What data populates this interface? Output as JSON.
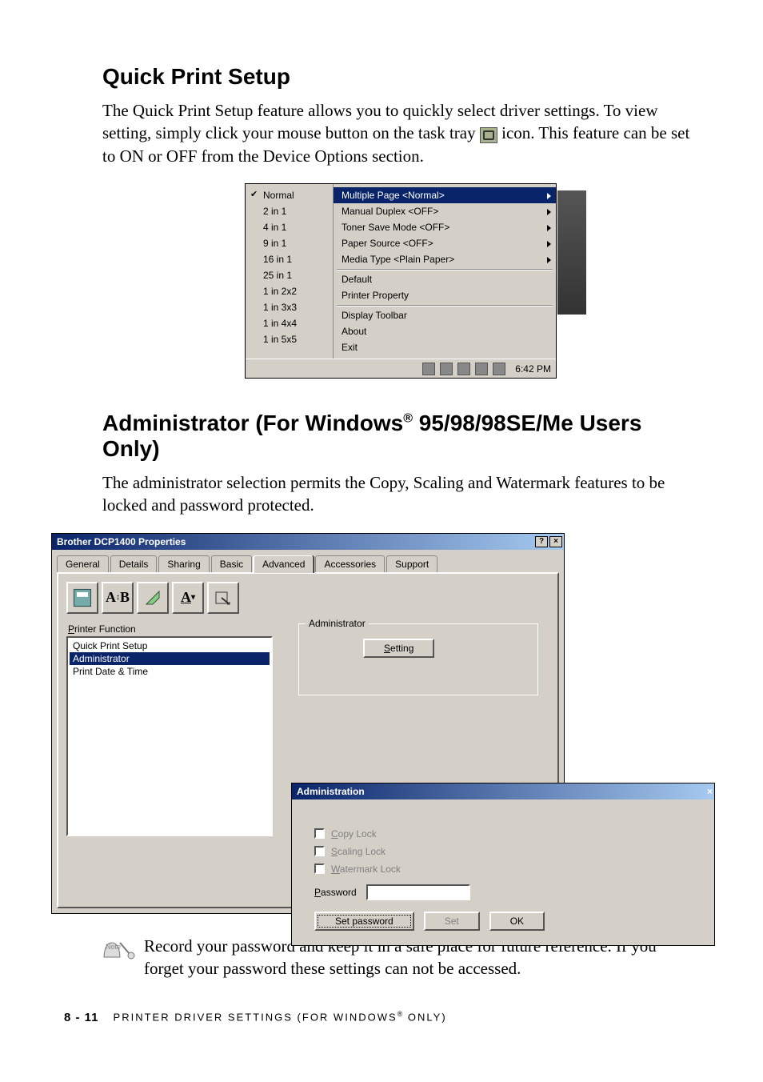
{
  "headings": {
    "qps": "Quick Print Setup",
    "admin": "Administrator (For Windows",
    "admin_suffix": " 95/98/98SE/Me Users Only)",
    "reg": "®"
  },
  "para": {
    "qps1a": "The Quick Print Setup feature allows you to quickly select driver settings. To view setting, simply click your mouse button on the task tray ",
    "qps1b": " icon. This feature can be set to ON or OFF from the Device Options section.",
    "admin1": "The administrator selection permits the Copy, Scaling and Watermark features to be locked and password protected.",
    "note": "Record your password and keep it in a safe place for future reference. If you forget your password these settings can not be accessed."
  },
  "qps_menu": {
    "left": [
      {
        "label": "Normal",
        "checked": true
      },
      {
        "label": "2 in 1"
      },
      {
        "label": "4 in 1"
      },
      {
        "label": "9 in 1"
      },
      {
        "label": "16 in 1"
      },
      {
        "label": "25 in 1"
      },
      {
        "label": "1 in 2x2"
      },
      {
        "label": "1 in 3x3"
      },
      {
        "label": "1 in 4x4"
      },
      {
        "label": "1 in 5x5"
      }
    ],
    "right_top": [
      {
        "label": "Multiple Page <Normal>",
        "hi": true,
        "arrow": true
      },
      {
        "label": "Manual Duplex <OFF>",
        "arrow": true
      },
      {
        "label": "Toner Save Mode <OFF>",
        "arrow": true
      },
      {
        "label": "Paper Source <OFF>",
        "arrow": true
      },
      {
        "label": "Media Type <Plain Paper>",
        "arrow": true
      }
    ],
    "right_mid": [
      {
        "label": "Default"
      },
      {
        "label": "Printer Property"
      }
    ],
    "right_bot": [
      {
        "label": "Display Toolbar"
      },
      {
        "label": "About"
      },
      {
        "label": "Exit"
      }
    ],
    "tray_time": "6:42 PM"
  },
  "props": {
    "title": "Brother DCP1400 Properties",
    "tabs": [
      "General",
      "Details",
      "Sharing",
      "Basic",
      "Advanced",
      "Accessories",
      "Support"
    ],
    "active_tab": "Advanced",
    "pf_label": "Printer Function",
    "pf_items": [
      "Quick Print Setup",
      "Administrator",
      "Print Date & Time"
    ],
    "pf_selected": "Administrator",
    "group_title": "Administrator",
    "setting_btn": "Setting"
  },
  "admin": {
    "title": "Administration",
    "checks": [
      "Copy Lock",
      "Scaling Lock",
      "Watermark Lock"
    ],
    "check_hot": [
      "C",
      "S",
      "W"
    ],
    "password_label": "Password",
    "setpw_btn": "Set password",
    "set_btn": "Set",
    "ok_btn": "OK"
  },
  "footer": {
    "page": "8 - 11",
    "chapter_a": "PRINTER DRIVER SETTINGS (FOR WINDOWS",
    "chapter_b": " ONLY)",
    "reg": "®"
  },
  "note_badge": "Note"
}
